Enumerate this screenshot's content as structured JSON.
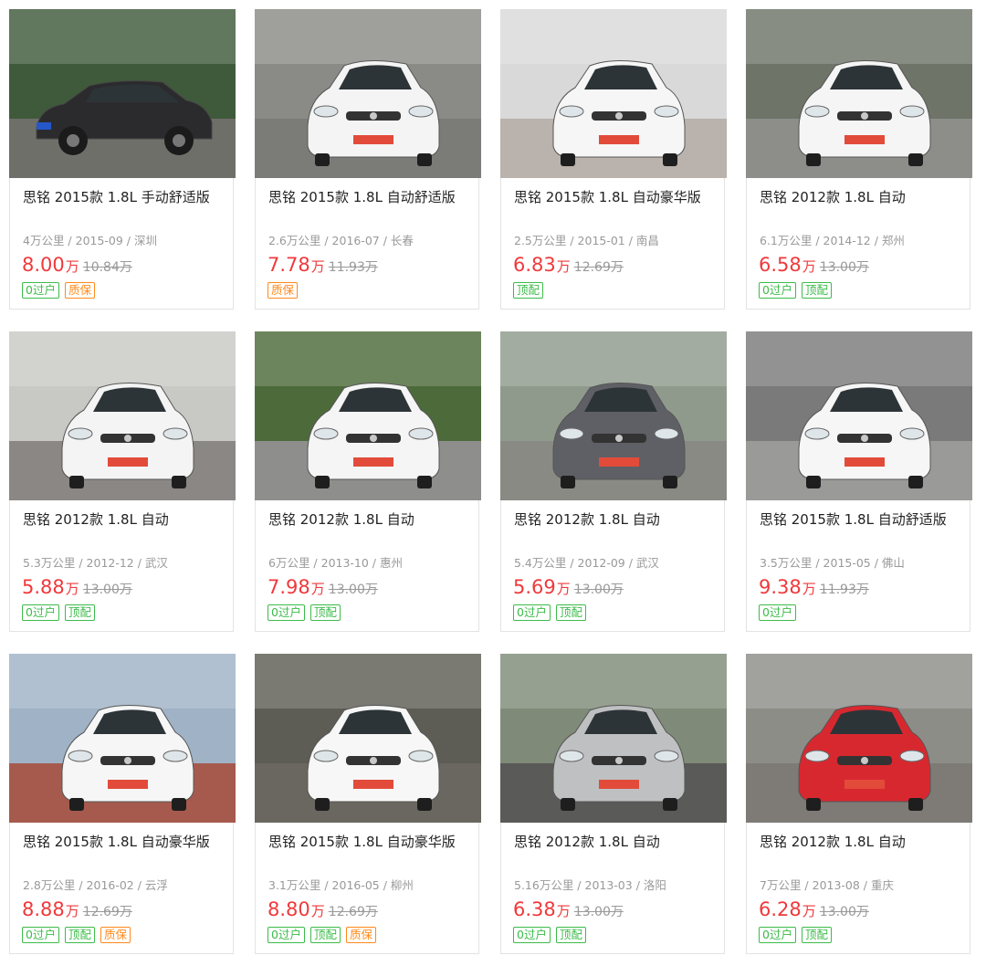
{
  "cars": [
    {
      "title": "思铭 2015款 1.8L 手动舒适版",
      "meta": "4万公里 / 2015-09 / 深圳",
      "price": "8.00",
      "unit": "万",
      "original": "10.84万",
      "tags": [
        {
          "label": "0过户",
          "color": "green"
        },
        {
          "label": "质保",
          "color": "orange"
        }
      ],
      "photo": {
        "bg": "#3f5a3b",
        "car": "#2b2b2e",
        "ground": "#6f6f6a",
        "view": "side"
      }
    },
    {
      "title": "思铭 2015款 1.8L 自动舒适版",
      "meta": "2.6万公里 / 2016-07 / 长春",
      "price": "7.78",
      "unit": "万",
      "original": "11.93万",
      "tags": [
        {
          "label": "质保",
          "color": "orange"
        }
      ],
      "photo": {
        "bg": "#8a8a86",
        "car": "#f4f4f4",
        "ground": "#7b7b78",
        "view": "front"
      }
    },
    {
      "title": "思铭 2015款 1.8L 自动豪华版",
      "meta": "2.5万公里 / 2015-01 / 南昌",
      "price": "6.83",
      "unit": "万",
      "original": "12.69万",
      "tags": [
        {
          "label": "顶配",
          "color": "green"
        }
      ],
      "photo": {
        "bg": "#d9d9d9",
        "car": "#f6f6f6",
        "ground": "#b9b2ad",
        "view": "front"
      }
    },
    {
      "title": "思铭 2012款 1.8L 自动",
      "meta": "6.1万公里 / 2014-12 / 郑州",
      "price": "6.58",
      "unit": "万",
      "original": "13.00万",
      "tags": [
        {
          "label": "0过户",
          "color": "green"
        },
        {
          "label": "顶配",
          "color": "green"
        }
      ],
      "photo": {
        "bg": "#6e7468",
        "car": "#f5f5f5",
        "ground": "#8d8d8a",
        "view": "front"
      }
    },
    {
      "title": "思铭 2012款 1.8L 自动",
      "meta": "5.3万公里 / 2012-12 / 武汉",
      "price": "5.88",
      "unit": "万",
      "original": "13.00万",
      "tags": [
        {
          "label": "0过户",
          "color": "green"
        },
        {
          "label": "顶配",
          "color": "green"
        }
      ],
      "photo": {
        "bg": "#c8c8c5",
        "car": "#f4f4f4",
        "ground": "#8a8784",
        "view": "front"
      }
    },
    {
      "title": "思铭 2012款 1.8L 自动",
      "meta": "6万公里 / 2013-10 / 惠州",
      "price": "7.98",
      "unit": "万",
      "original": "13.00万",
      "tags": [
        {
          "label": "0过户",
          "color": "green"
        },
        {
          "label": "顶配",
          "color": "green"
        }
      ],
      "photo": {
        "bg": "#4d6b3a",
        "car": "#f5f5f5",
        "ground": "#8e8e8c",
        "view": "front"
      }
    },
    {
      "title": "思铭 2012款 1.8L 自动",
      "meta": "5.4万公里 / 2012-09 / 武汉",
      "price": "5.69",
      "unit": "万",
      "original": "13.00万",
      "tags": [
        {
          "label": "0过户",
          "color": "green"
        },
        {
          "label": "顶配",
          "color": "green"
        }
      ],
      "photo": {
        "bg": "#8f9a8c",
        "car": "#5f6066",
        "ground": "#8a8a84",
        "view": "front"
      }
    },
    {
      "title": "思铭 2015款 1.8L 自动舒适版",
      "meta": "3.5万公里 / 2015-05 / 佛山",
      "price": "9.38",
      "unit": "万",
      "original": "11.93万",
      "tags": [
        {
          "label": "0过户",
          "color": "green"
        }
      ],
      "photo": {
        "bg": "#7a7a7a",
        "car": "#f6f6f6",
        "ground": "#9a9a98",
        "view": "front"
      }
    },
    {
      "title": "思铭 2015款 1.8L 自动豪华版",
      "meta": "2.8万公里 / 2016-02 / 云浮",
      "price": "8.88",
      "unit": "万",
      "original": "12.69万",
      "tags": [
        {
          "label": "0过户",
          "color": "green"
        },
        {
          "label": "顶配",
          "color": "green"
        },
        {
          "label": "质保",
          "color": "orange"
        }
      ],
      "photo": {
        "bg": "#9fb2c6",
        "car": "#f6f6f6",
        "ground": "#a65a4e",
        "view": "front"
      }
    },
    {
      "title": "思铭 2015款 1.8L 自动豪华版",
      "meta": "3.1万公里 / 2016-05 / 柳州",
      "price": "8.80",
      "unit": "万",
      "original": "12.69万",
      "tags": [
        {
          "label": "0过户",
          "color": "green"
        },
        {
          "label": "顶配",
          "color": "green"
        },
        {
          "label": "质保",
          "color": "orange"
        }
      ],
      "photo": {
        "bg": "#5d5d55",
        "car": "#f7f7f7",
        "ground": "#6a6760",
        "view": "front"
      }
    },
    {
      "title": "思铭 2012款 1.8L 自动",
      "meta": "5.16万公里 / 2013-03 / 洛阳",
      "price": "6.38",
      "unit": "万",
      "original": "13.00万",
      "tags": [
        {
          "label": "0过户",
          "color": "green"
        },
        {
          "label": "顶配",
          "color": "green"
        }
      ],
      "photo": {
        "bg": "#7f8b78",
        "car": "#bfc0c2",
        "ground": "#5a5a58",
        "view": "front"
      }
    },
    {
      "title": "思铭 2012款 1.8L 自动",
      "meta": "7万公里 / 2013-08 / 重庆",
      "price": "6.28",
      "unit": "万",
      "original": "13.00万",
      "tags": [
        {
          "label": "0过户",
          "color": "green"
        },
        {
          "label": "顶配",
          "color": "green"
        }
      ],
      "photo": {
        "bg": "#8d8d88",
        "car": "#d8282f",
        "ground": "#7e7b76",
        "view": "front"
      }
    }
  ]
}
